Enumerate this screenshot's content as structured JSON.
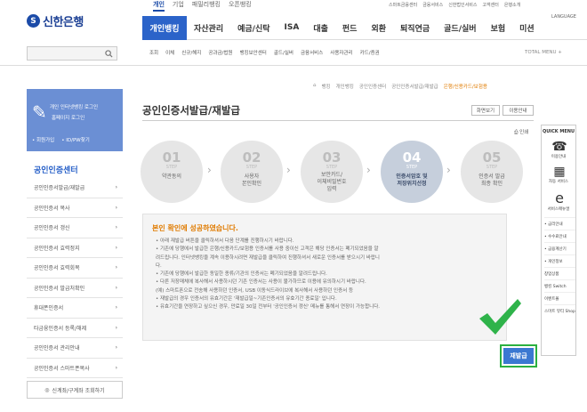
{
  "header": {
    "logo_text": "신한은행",
    "top_tabs": [
      "개인",
      "기업",
      "패밀리뱅킹",
      "오픈뱅킹"
    ],
    "util_links": [
      "스마트금융센터",
      "금융서비스",
      "신한법인서비스",
      "고객센터",
      "은행소개",
      "LANGUAGE"
    ],
    "main_nav": [
      "개인뱅킹",
      "자산관리",
      "예금/신탁",
      "ISA",
      "대출",
      "펀드",
      "외환",
      "퇴직연금",
      "골드/실버",
      "보험",
      "미션"
    ],
    "sub_nav": [
      "조회",
      "이체",
      "신규/해지",
      "공과금/법원",
      "뱅킹보안센터",
      "골드/실버",
      "금융서비스",
      "사용자관리",
      "카드/증권"
    ],
    "total_menu": "TOTAL MENU +"
  },
  "sidebar": {
    "login_line1": "개인 인터넷뱅킹 로그인",
    "login_line2": "홈페이지 로그인",
    "login_links": [
      "회원가입",
      "ID/PW찾기"
    ],
    "section_title": "공인인증센터",
    "items": [
      "공인인증서발급/재발급",
      "공인인증서 복사",
      "공인인증서 갱신",
      "공인인증서 효력정지",
      "공인인증서 효력회복",
      "공인인증서 발급처확인",
      "휴대폰인증서",
      "타금융인증서 등록/해제",
      "공인인증서 관리안내",
      "공인인증서 스마트폰복사"
    ],
    "bottom_button": "신계좌/구계좌 조회하기"
  },
  "content": {
    "breadcrumb": [
      "뱅킹",
      "개인뱅킹",
      "공인인증센터",
      "공인인증서발급/재발급",
      "은행/신용카드/보험용"
    ],
    "title": "공인인증서발급/재발급",
    "btn_print_guide": "화면보기",
    "btn_help": "이용안내",
    "print_label": "인쇄",
    "steps": [
      {
        "num": "01",
        "label": "STEP",
        "text": "약관동의"
      },
      {
        "num": "02",
        "label": "STEP",
        "text": "사용자\n본인확인"
      },
      {
        "num": "03",
        "label": "STEP",
        "text": "보안카드/\n이체비밀번호\n입력"
      },
      {
        "num": "04",
        "label": "STEP",
        "text": "인증서암호 및\n저장위치선정"
      },
      {
        "num": "05",
        "label": "STEP",
        "text": "인증서 발급\n최종 확인"
      }
    ],
    "message_title": "본인 확인에 성공하였습니다.",
    "message_items": [
      "• 아래 재발급 버튼을 클릭하셔서 다음 단계를 진행하시기 바랍니다.",
      "• 기존에 당행에서 발급한 은행/신용카드/보험용 인증서를 사용 중이신 고객은 해당 인증서는 폐기되었음을 알",
      "  려드립니다. 인터넷뱅킹을 계속 이용하시려면 재발급을 클릭하여 진행하셔서 새로운 인증서를 받으시기 바랍니",
      "  다.",
      "• 기존에 당행에서 발급한 동일한 종류/기관의 인증서는 폐기되었음을 알려드립니다.",
      "• 다른 저장매체에 복사해서 사용하시던 기존 인증서는 사용이 불가하므로 이용에 유의하시기 바랍니다.",
      "  (예) 스마트폰으로 전송해 사용하던 인증서, USB 이동식드라이브에 복사해서 사용하던 인증서 등",
      "• 재발급의 경우 인증서의 유효기간은 '재발급일~기존인증서의 유효기간 종료일' 입니다.",
      "• 유효기간을 연장하고 싶으신 경우, 만료일 30일 전부터 '공인인증서 갱신' 메뉴를 통해서 연장이 가능합니다."
    ],
    "reissue_button": "재발급"
  },
  "quick_menu": {
    "title": "QUICK MENU",
    "icons": [
      "이용안내",
      "자동 서비스",
      "서비스매뉴얼"
    ],
    "links": [
      "• 금리안내",
      "• 수수료안내",
      "• 금융계산기",
      "• 개인정보"
    ],
    "bottom": [
      "창업상품",
      "뱅킹 Switch",
      "이벤트몰",
      "스마트 뷰티 Shop"
    ]
  }
}
